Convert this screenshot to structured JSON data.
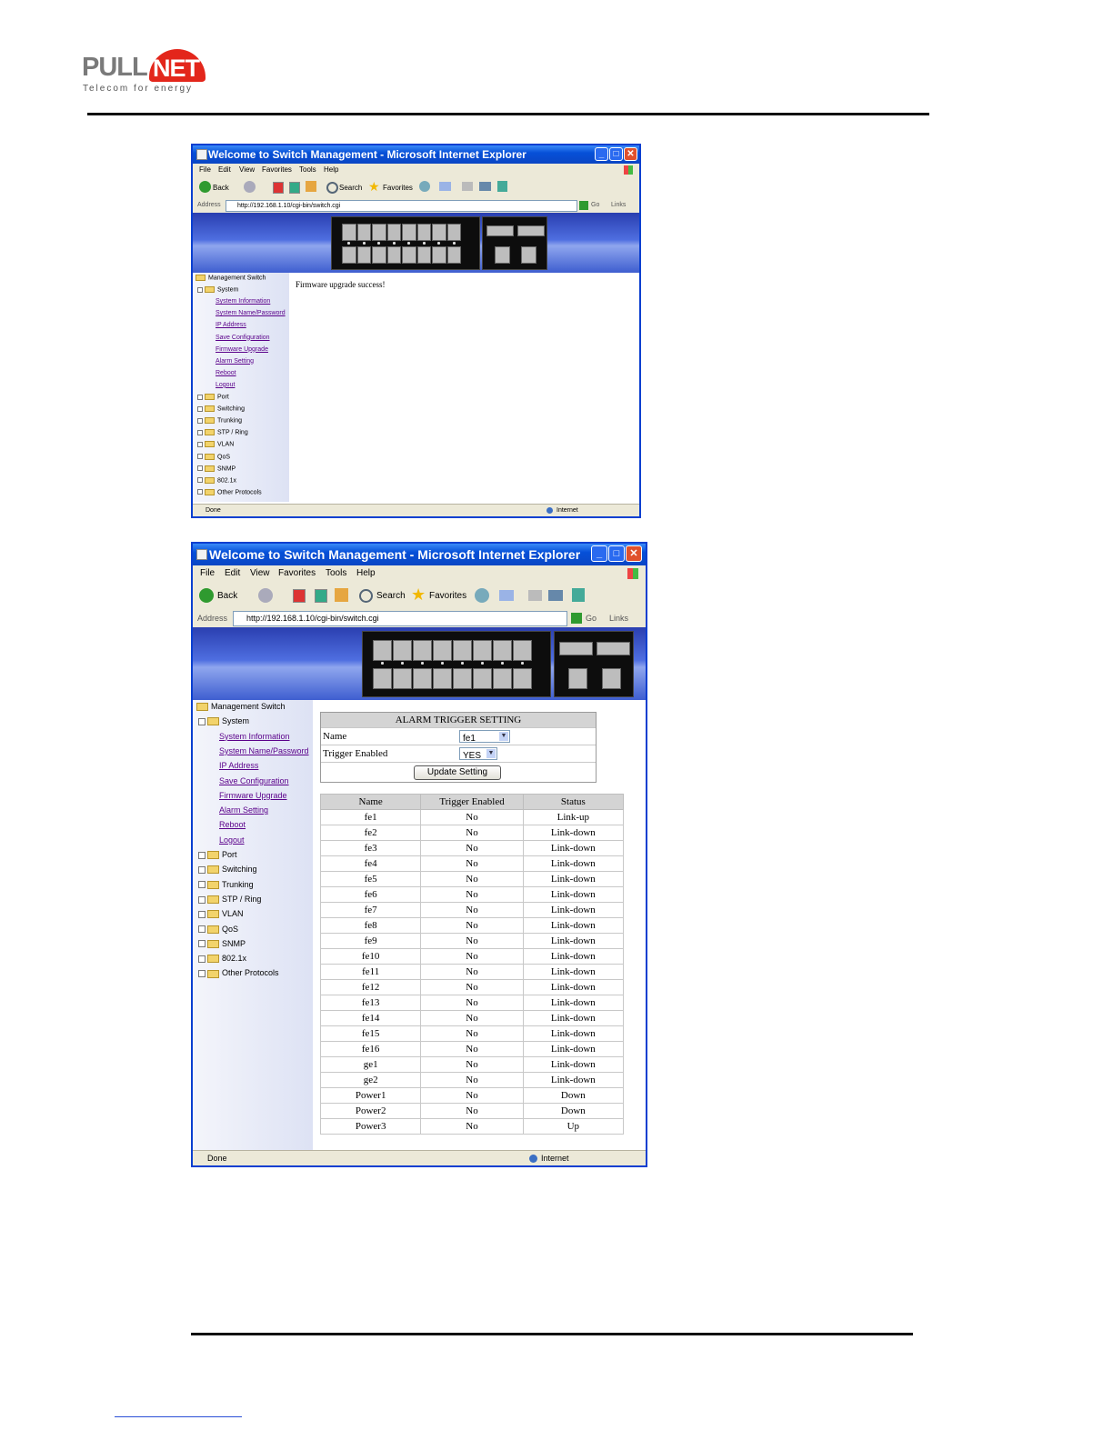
{
  "logo": {
    "brand_pull": "PULL",
    "brand_net": "NET",
    "tagline": "Telecom for energy"
  },
  "window1": {
    "title": "Welcome to Switch Management - Microsoft Internet Explorer",
    "menu": [
      "File",
      "Edit",
      "View",
      "Favorites",
      "Tools",
      "Help"
    ],
    "toolbar": {
      "back": "Back",
      "search": "Search",
      "favorites": "Favorites"
    },
    "address_label": "Address",
    "address": "http://192.168.1.10/cgi-bin/switch.cgi",
    "go": "Go",
    "links": "Links",
    "message": "Firmware upgrade success!",
    "status_left": "Done",
    "status_right": "Internet"
  },
  "window2": {
    "title": "Welcome to Switch Management - Microsoft Internet Explorer",
    "menu": [
      "File",
      "Edit",
      "View",
      "Favorites",
      "Tools",
      "Help"
    ],
    "toolbar": {
      "back": "Back",
      "search": "Search",
      "favorites": "Favorites"
    },
    "address_label": "Address",
    "address": "http://192.168.1.10/cgi-bin/switch.cgi",
    "go": "Go",
    "links": "Links",
    "status_left": "Done",
    "status_right": "Internet"
  },
  "tree": {
    "root": "Management Switch",
    "system": "System",
    "system_links": [
      "System Information",
      "System Name/Password",
      "IP Address",
      "Save Configuration",
      "Firmware Upgrade",
      "Alarm Setting",
      "Reboot",
      "Logout"
    ],
    "folders": [
      "Port",
      "Switching",
      "Trunking",
      "STP / Ring",
      "VLAN",
      "QoS",
      "SNMP",
      "802.1x",
      "Other Protocols"
    ]
  },
  "alarm": {
    "title": "ALARM TRIGGER SETTING",
    "name_label": "Name",
    "name_value": "fe1",
    "trigger_label": "Trigger Enabled",
    "trigger_value": "YES",
    "update_button": "Update Setting",
    "columns": [
      "Name",
      "Trigger Enabled",
      "Status"
    ],
    "rows": [
      [
        "fe1",
        "No",
        "Link-up"
      ],
      [
        "fe2",
        "No",
        "Link-down"
      ],
      [
        "fe3",
        "No",
        "Link-down"
      ],
      [
        "fe4",
        "No",
        "Link-down"
      ],
      [
        "fe5",
        "No",
        "Link-down"
      ],
      [
        "fe6",
        "No",
        "Link-down"
      ],
      [
        "fe7",
        "No",
        "Link-down"
      ],
      [
        "fe8",
        "No",
        "Link-down"
      ],
      [
        "fe9",
        "No",
        "Link-down"
      ],
      [
        "fe10",
        "No",
        "Link-down"
      ],
      [
        "fe11",
        "No",
        "Link-down"
      ],
      [
        "fe12",
        "No",
        "Link-down"
      ],
      [
        "fe13",
        "No",
        "Link-down"
      ],
      [
        "fe14",
        "No",
        "Link-down"
      ],
      [
        "fe15",
        "No",
        "Link-down"
      ],
      [
        "fe16",
        "No",
        "Link-down"
      ],
      [
        "ge1",
        "No",
        "Link-down"
      ],
      [
        "ge2",
        "No",
        "Link-down"
      ],
      [
        "Power1",
        "No",
        "Down"
      ],
      [
        "Power2",
        "No",
        "Down"
      ],
      [
        "Power3",
        "No",
        "Up"
      ]
    ]
  }
}
